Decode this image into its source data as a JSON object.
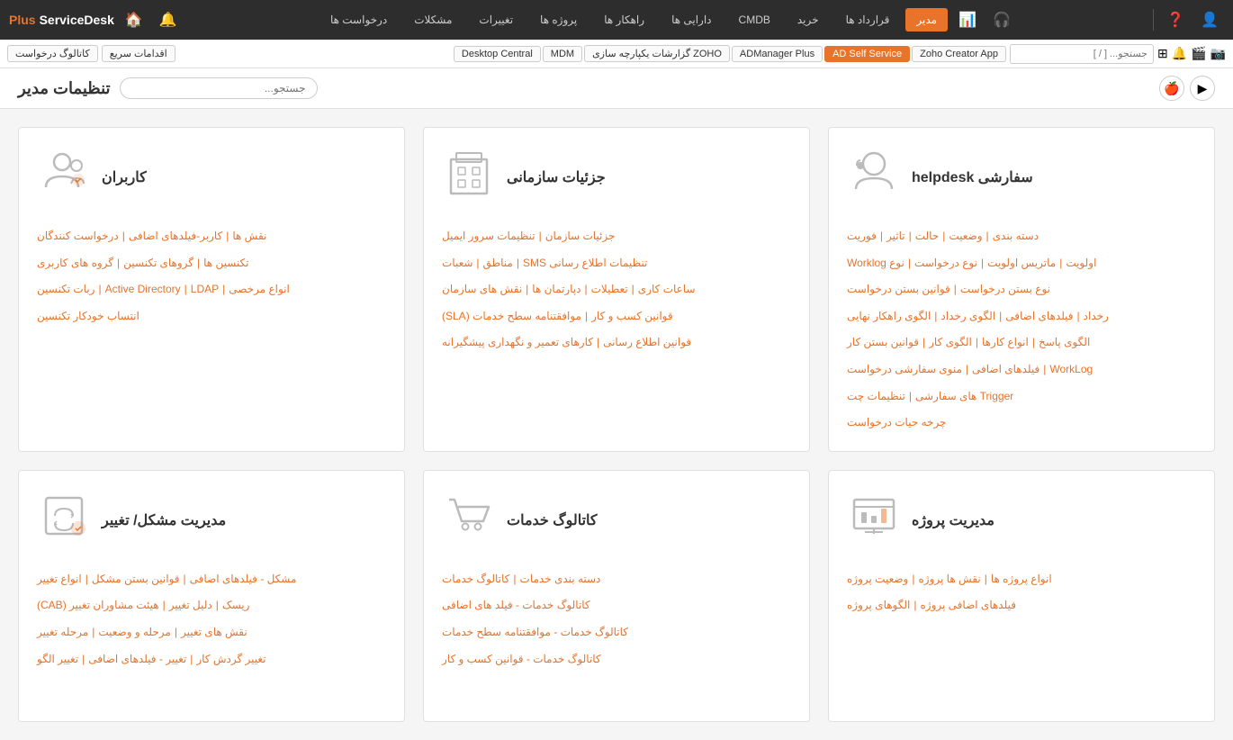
{
  "topNav": {
    "tabs": [
      {
        "id": "headphones",
        "label": "🎧",
        "isIcon": true
      },
      {
        "id": "chart",
        "label": "📊",
        "isIcon": true
      },
      {
        "id": "admin",
        "label": "مدیر",
        "active": true
      },
      {
        "id": "contracts",
        "label": "قرارداد ها"
      },
      {
        "id": "buy",
        "label": "خرید"
      },
      {
        "id": "cmdb",
        "label": "CMDB"
      },
      {
        "id": "assets",
        "label": "دارایی ها"
      },
      {
        "id": "solutions",
        "label": "راهکار ها"
      },
      {
        "id": "projects",
        "label": "پروژه ها"
      },
      {
        "id": "changes",
        "label": "تغییرات"
      },
      {
        "id": "problems",
        "label": "مشکلات"
      },
      {
        "id": "requests",
        "label": "درخواست ها"
      }
    ],
    "brandName": "ServiceDesk",
    "brandPlus": "Plus",
    "homeLabel": "🏠",
    "notifLabel": "🔔",
    "settingsLabel": "⚙"
  },
  "bookmarkBar": {
    "searchPlaceholder": "جستجو... [ / ]",
    "links": [
      {
        "label": "Zoho Creator App"
      },
      {
        "label": "AD Self Service",
        "active": true
      },
      {
        "label": "ADManager Plus"
      },
      {
        "label": "ZOHO گزارشات یکپارچه سازی"
      },
      {
        "label": "MDM"
      },
      {
        "label": "Desktop Central"
      }
    ],
    "quickAction": "اقدامات سریع",
    "catalog": "کاتالوگ درخواست"
  },
  "pageHeader": {
    "title": "تنظیمات مدیر",
    "searchPlaceholder": "جستجو..."
  },
  "sections": [
    {
      "id": "helpdesk",
      "title": "سفارشی helpdesk",
      "iconType": "headset",
      "rows": [
        [
          "دسته بندی",
          "وضعیت",
          "حالت",
          "تاثیر",
          "فوریت"
        ],
        [
          "اولویت",
          "ماتریس اولویت",
          "نوع درخواست",
          "نوع Worklog"
        ],
        [
          "نوع بستن درخواست",
          "قوانین بستن درخواست"
        ],
        [
          "رخداد",
          "فیلدهای اضافی",
          "الگوی رخداد",
          "الگوی راهکار نهایی"
        ],
        [
          "الگوی پاسخ",
          "انواع کارها",
          "الگوی کار",
          "قوانین بستن کار"
        ],
        [
          "WorkLog",
          "فیلدهای اضافی",
          "منوی سفارشی درخواست"
        ],
        [
          "Trigger های سفارشی",
          "تنظیمات چت"
        ],
        [
          "چرخه حیات درخواست"
        ]
      ]
    },
    {
      "id": "org",
      "title": "جزئیات سازمانی",
      "iconType": "building",
      "rows": [
        [
          "جزئیات سازمان",
          "تنظیمات سرور ایمیل"
        ],
        [
          "تنظیمات اطلاع رسانی SMS",
          "مناطق",
          "شعبات"
        ],
        [
          "ساعات کاری",
          "تعطیلات",
          "دپارتمان ها",
          "نقش های سازمان"
        ],
        [
          "قوانین کسب و کار",
          "موافقتنامه سطح خدمات (SLA)"
        ],
        [
          "قوانین اطلاع رسانی",
          "کارهای تعمیر و نگهداری پیشگیرانه"
        ]
      ]
    },
    {
      "id": "users",
      "title": "کاربران",
      "iconType": "users",
      "rows": [
        [
          "نقش ها",
          "کاربر-فیلدهای اضافی",
          "درخواست کنندگان"
        ],
        [
          "تکنسین ها",
          "گروهای تکنسین",
          "گروه های کاربری"
        ],
        [
          "انواع مرخصی",
          "LDAP",
          "Active Directory",
          "ربات تکنسین"
        ],
        [
          "انتساب خودکار تکنسین"
        ]
      ]
    },
    {
      "id": "projects",
      "title": "مدیریت پروژه",
      "iconType": "chart-bar",
      "rows": [
        [
          "انواع پروژه ها",
          "نقش ها پروژه",
          "وضعیت پروژه"
        ],
        [
          "فیلدهای اضافی پروژه",
          "الگوهای پروژه"
        ]
      ]
    },
    {
      "id": "catalog",
      "title": "کاتالوگ خدمات",
      "iconType": "cart",
      "rows": [
        [
          "دسته بندی خدمات",
          "کاتالوگ خدمات"
        ],
        [
          "کاتالوگ خدمات - فیلد های اضافی"
        ],
        [
          "کاتالوگ خدمات - موافقتنامه سطح خدمات"
        ],
        [
          "کاتالوگ خدمات - قوانین کسب و کار"
        ]
      ]
    },
    {
      "id": "change",
      "title": "مدیریت مشکل/ تغییر",
      "iconType": "change",
      "rows": [
        [
          "مشکل - فیلدهای اضافی",
          "قوانین بستن مشکل",
          "انواع تغییر"
        ],
        [
          "ریسک - دلیل تغییر",
          "هیئت مشاوران تغییر (CAB)"
        ],
        [
          "نقش های تغییر",
          "مرحله و وضعیت",
          "مرحله تغییر"
        ],
        [
          "تغییر گردش کار",
          "تغییر - فیلدهای اضافی",
          "تغییر الگو"
        ]
      ]
    }
  ]
}
